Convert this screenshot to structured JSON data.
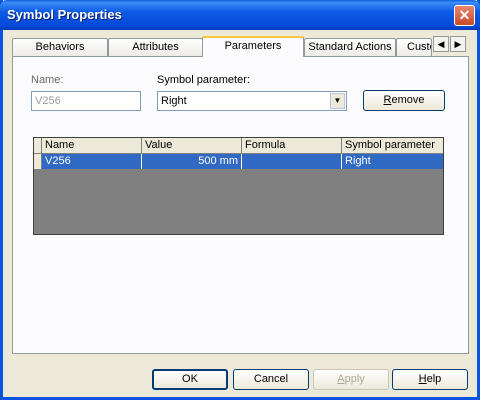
{
  "window": {
    "title": "Symbol Properties",
    "close_glyph": "✕"
  },
  "tabs": [
    {
      "label": "Behaviors"
    },
    {
      "label": "Attributes"
    },
    {
      "label": "Parameters",
      "active": true
    },
    {
      "label": "Standard Actions"
    },
    {
      "label": "Custo"
    }
  ],
  "tab_scroll": {
    "left_glyph": "◀",
    "right_glyph": "▶"
  },
  "form": {
    "name_label": "Name:",
    "name_value": "V256",
    "symbol_parameter_label": "Symbol parameter:",
    "symbol_parameter_value": "Right",
    "combo_arrow": "▼",
    "remove_prefix": "",
    "remove_accel": "R",
    "remove_rest": "emove"
  },
  "grid": {
    "columns": [
      "Name",
      "Value",
      "Formula",
      "Symbol parameter"
    ],
    "rows": [
      {
        "name": "V256",
        "value": "500 mm",
        "formula": "",
        "symbol_parameter": "Right",
        "selected": true
      }
    ]
  },
  "footer": {
    "ok_label": "OK",
    "cancel_label": "Cancel",
    "apply_accel": "A",
    "apply_rest": "pply",
    "help_accel": "H",
    "help_rest": "elp"
  },
  "colors": {
    "title_bar": "#0a54e3",
    "selection": "#316ac5",
    "grid_background": "#808080",
    "dialog_background": "#ece9d8"
  }
}
